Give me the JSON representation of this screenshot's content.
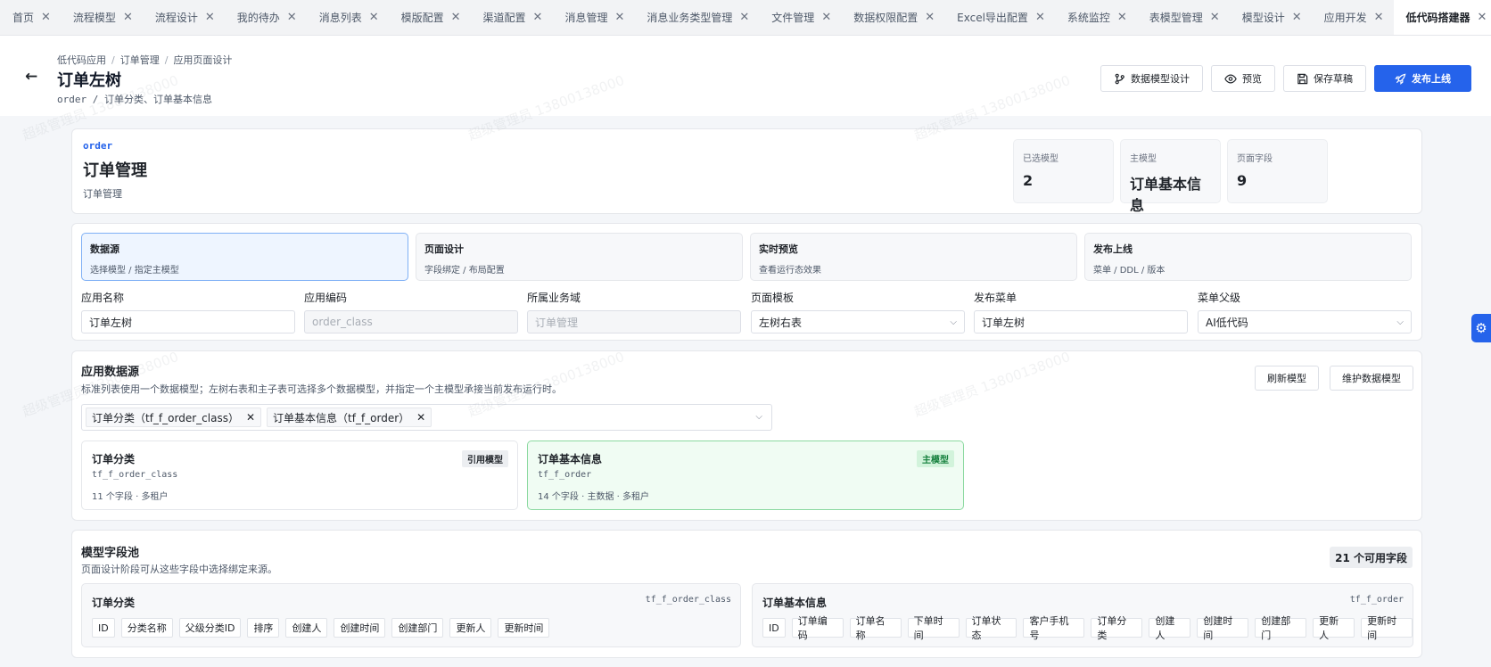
{
  "tabs": [
    {
      "label": "首页"
    },
    {
      "label": "流程模型"
    },
    {
      "label": "流程设计"
    },
    {
      "label": "我的待办"
    },
    {
      "label": "消息列表"
    },
    {
      "label": "模版配置"
    },
    {
      "label": "渠道配置"
    },
    {
      "label": "消息管理"
    },
    {
      "label": "消息业务类型管理"
    },
    {
      "label": "文件管理"
    },
    {
      "label": "数据权限配置"
    },
    {
      "label": "Excel导出配置"
    },
    {
      "label": "系统监控"
    },
    {
      "label": "表模型管理"
    },
    {
      "label": "模型设计"
    },
    {
      "label": "应用开发"
    },
    {
      "label": "低代码搭建器",
      "active": true
    }
  ],
  "header": {
    "breadcrumb": [
      "低代码应用",
      "订单管理",
      "应用页面设计"
    ],
    "title": "订单左树",
    "subtitle": "order / 订单分类、订单基本信息",
    "buttons": {
      "model_design": "数据模型设计",
      "preview": "预览",
      "save_draft": "保存草稿",
      "publish": "发布上线"
    }
  },
  "summary": {
    "code": "order",
    "title": "订单管理",
    "desc": "订单管理",
    "stats": [
      {
        "label": "已选模型",
        "value": "2"
      },
      {
        "label": "主模型",
        "value": "订单基本信息"
      },
      {
        "label": "页面字段",
        "value": "9"
      }
    ]
  },
  "steps": [
    {
      "title": "数据源",
      "desc": "选择模型 / 指定主模型",
      "active": true
    },
    {
      "title": "页面设计",
      "desc": "字段绑定 / 布局配置"
    },
    {
      "title": "实时预览",
      "desc": "查看运行态效果"
    },
    {
      "title": "发布上线",
      "desc": "菜单 / DDL / 版本"
    }
  ],
  "form": {
    "app_name": {
      "label": "应用名称",
      "value": "订单左树"
    },
    "app_code": {
      "label": "应用编码",
      "placeholder": "order_class"
    },
    "domain": {
      "label": "所属业务域",
      "placeholder": "订单管理"
    },
    "template": {
      "label": "页面模板",
      "value": "左树右表"
    },
    "menu": {
      "label": "发布菜单",
      "value": "订单左树"
    },
    "parent_menu": {
      "label": "菜单父级",
      "value": "AI低代码"
    }
  },
  "datasource": {
    "title": "应用数据源",
    "desc": "标准列表使用一个数据模型；左树右表和主子表可选择多个数据模型，并指定一个主模型承接当前发布运行时。",
    "refresh": "刷新模型",
    "maintain": "维护数据模型",
    "selected": [
      "订单分类（tf_f_order_class）",
      "订单基本信息（tf_f_order）"
    ],
    "models": [
      {
        "name": "订单分类",
        "table": "tf_f_order_class",
        "meta": "11 个字段 · 多租户",
        "badge": "引用模型"
      },
      {
        "name": "订单基本信息",
        "table": "tf_f_order",
        "meta": "14 个字段 · 主数据 · 多租户",
        "badge": "主模型"
      }
    ]
  },
  "pool": {
    "title": "模型字段池",
    "desc": "页面设计阶段可从这些字段中选择绑定来源。",
    "count": "21 个可用字段",
    "groups": [
      {
        "name": "订单分类",
        "table": "tf_f_order_class",
        "fields": [
          "ID",
          "分类名称",
          "父级分类ID",
          "排序",
          "创建人",
          "创建时间",
          "创建部门",
          "更新人",
          "更新时间"
        ]
      },
      {
        "name": "订单基本信息",
        "table": "tf_f_order",
        "fields": [
          "ID",
          "订单编码",
          "订单名称",
          "下单时间",
          "订单状态",
          "客户手机号",
          "订单分类",
          "创建人",
          "创建时间",
          "创建部门",
          "更新人",
          "更新时间"
        ]
      }
    ]
  },
  "watermark": "超级管理员 13800138000",
  "colors": {
    "primary": "#2563eb",
    "success": "#15803d"
  }
}
